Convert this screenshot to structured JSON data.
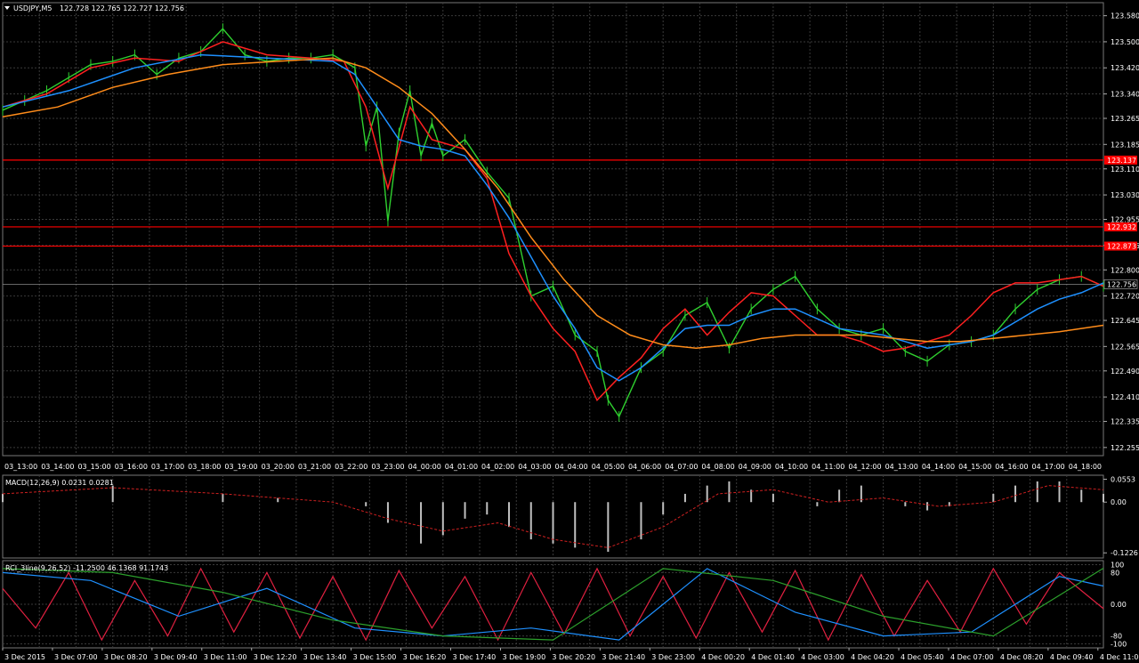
{
  "chart_data": [
    {
      "type": "line",
      "title": "USDJPY,M5",
      "ohlc_text": "122.728 122.765 122.727 122.756",
      "ylim": [
        122.23,
        123.62
      ],
      "y_ticks": [
        "123.580",
        "123.500",
        "123.420",
        "123.340",
        "123.265",
        "123.185",
        "123.110",
        "123.030",
        "122.955",
        "122.875",
        "122.800",
        "122.720",
        "122.645",
        "122.565",
        "122.490",
        "122.410",
        "122.335",
        "122.255"
      ],
      "x_markers": [
        "03_13:00",
        "03_14:00",
        "03_15:00",
        "03_16:00",
        "03_17:00",
        "03_18:00",
        "03_19:00",
        "03_20:00",
        "03_21:00",
        "03_22:00",
        "03_23:00",
        "04_00:00",
        "04_01:00",
        "04_02:00",
        "04_03:00",
        "04_04:00",
        "04_05:00",
        "04_06:00",
        "04_07:00",
        "04_08:00",
        "04_09:00",
        "04_10:00",
        "04_11:00",
        "04_12:00",
        "04_13:00",
        "04_14:00",
        "04_15:00",
        "04_16:00",
        "04_17:00",
        "04_18:00"
      ],
      "x_labels": [
        "3 Dec 2015",
        "3 Dec 07:00",
        "3 Dec 08:20",
        "3 Dec 09:40",
        "3 Dec 11:00",
        "3 Dec 12:20",
        "3 Dec 13:40",
        "3 Dec 15:00",
        "3 Dec 16:20",
        "3 Dec 17:40",
        "3 Dec 19:00",
        "3 Dec 20:20",
        "3 Dec 21:40",
        "3 Dec 23:00",
        "4 Dec 00:20",
        "4 Dec 01:40",
        "4 Dec 03:00",
        "4 Dec 04:20",
        "4 Dec 05:40",
        "4 Dec 07:00",
        "4 Dec 08:20",
        "4 Dec 09:40",
        "4 Dec 11:00"
      ],
      "horizontal_levels": [
        {
          "value": 123.137,
          "label": "123.137",
          "color": "#ff0000"
        },
        {
          "value": 122.932,
          "label": "122.932",
          "color": "#ff0000"
        },
        {
          "value": 122.873,
          "label": "122.873",
          "color": "#ff0000"
        }
      ],
      "current_price": {
        "value": 122.756,
        "label": "122.756"
      },
      "price_color": "#2fd02f",
      "series": [
        {
          "color": "#2fd02f",
          "role": "price",
          "x": [
            0,
            0.02,
            0.04,
            0.06,
            0.08,
            0.1,
            0.12,
            0.14,
            0.16,
            0.18,
            0.2,
            0.22,
            0.24,
            0.26,
            0.28,
            0.3,
            0.32,
            0.33,
            0.34,
            0.35,
            0.36,
            0.37,
            0.38,
            0.39,
            0.4,
            0.42,
            0.44,
            0.46,
            0.48,
            0.5,
            0.52,
            0.54,
            0.55,
            0.56,
            0.58,
            0.6,
            0.62,
            0.64,
            0.66,
            0.68,
            0.7,
            0.72,
            0.74,
            0.76,
            0.78,
            0.8,
            0.82,
            0.84,
            0.86,
            0.88,
            0.9,
            0.92,
            0.94,
            0.96,
            0.98,
            1
          ],
          "y": [
            123.29,
            123.32,
            123.35,
            123.39,
            123.43,
            123.44,
            123.46,
            123.4,
            123.45,
            123.47,
            123.54,
            123.46,
            123.44,
            123.45,
            123.45,
            123.46,
            123.42,
            123.18,
            123.3,
            122.95,
            123.22,
            123.35,
            123.15,
            123.25,
            123.15,
            123.2,
            123.1,
            123.02,
            122.72,
            122.75,
            122.6,
            122.55,
            122.4,
            122.35,
            122.5,
            122.55,
            122.66,
            122.7,
            122.56,
            122.68,
            122.74,
            122.78,
            122.68,
            122.62,
            122.6,
            122.62,
            122.55,
            122.52,
            122.57,
            122.58,
            122.6,
            122.68,
            122.74,
            122.77,
            122.78,
            122.75
          ]
        },
        {
          "color": "#ff2020",
          "role": "fast-ma",
          "x": [
            0,
            0.04,
            0.08,
            0.12,
            0.16,
            0.2,
            0.24,
            0.28,
            0.31,
            0.33,
            0.35,
            0.37,
            0.39,
            0.42,
            0.44,
            0.46,
            0.48,
            0.5,
            0.52,
            0.54,
            0.56,
            0.58,
            0.6,
            0.62,
            0.64,
            0.66,
            0.68,
            0.7,
            0.72,
            0.74,
            0.76,
            0.78,
            0.8,
            0.82,
            0.84,
            0.86,
            0.88,
            0.9,
            0.92,
            0.94,
            0.96,
            0.98,
            1
          ],
          "y": [
            123.3,
            123.34,
            123.42,
            123.45,
            123.44,
            123.5,
            123.46,
            123.45,
            123.44,
            123.3,
            123.05,
            123.3,
            123.2,
            123.17,
            123.08,
            122.85,
            122.72,
            122.62,
            122.55,
            122.4,
            122.47,
            122.53,
            122.62,
            122.68,
            122.6,
            122.67,
            122.73,
            122.72,
            122.66,
            122.6,
            122.6,
            122.58,
            122.55,
            122.56,
            122.58,
            122.6,
            122.66,
            122.73,
            122.76,
            122.76,
            122.77,
            122.78,
            122.75
          ]
        },
        {
          "color": "#1e90ff",
          "role": "mid-ma",
          "x": [
            0,
            0.06,
            0.12,
            0.18,
            0.24,
            0.3,
            0.32,
            0.34,
            0.36,
            0.38,
            0.4,
            0.42,
            0.44,
            0.46,
            0.48,
            0.5,
            0.52,
            0.54,
            0.56,
            0.58,
            0.6,
            0.62,
            0.64,
            0.66,
            0.68,
            0.7,
            0.72,
            0.74,
            0.76,
            0.78,
            0.8,
            0.82,
            0.84,
            0.86,
            0.88,
            0.9,
            0.92,
            0.94,
            0.96,
            0.98,
            1
          ],
          "y": [
            123.3,
            123.35,
            123.42,
            123.46,
            123.45,
            123.44,
            123.4,
            123.3,
            123.2,
            123.18,
            123.17,
            123.15,
            123.06,
            122.96,
            122.84,
            122.72,
            122.62,
            122.5,
            122.46,
            122.5,
            122.56,
            122.62,
            122.63,
            122.63,
            122.66,
            122.68,
            122.68,
            122.65,
            122.62,
            122.61,
            122.6,
            122.58,
            122.56,
            122.57,
            122.58,
            122.6,
            122.64,
            122.68,
            122.71,
            122.73,
            122.76
          ]
        },
        {
          "color": "#ff8c1a",
          "role": "slow-ma",
          "x": [
            0,
            0.05,
            0.1,
            0.15,
            0.2,
            0.25,
            0.3,
            0.33,
            0.36,
            0.39,
            0.42,
            0.45,
            0.48,
            0.51,
            0.54,
            0.57,
            0.6,
            0.63,
            0.66,
            0.69,
            0.72,
            0.75,
            0.78,
            0.81,
            0.84,
            0.87,
            0.9,
            0.93,
            0.96,
            1
          ],
          "y": [
            123.27,
            123.3,
            123.36,
            123.4,
            123.43,
            123.44,
            123.45,
            123.42,
            123.36,
            123.28,
            123.17,
            123.05,
            122.9,
            122.77,
            122.66,
            122.6,
            122.57,
            122.56,
            122.57,
            122.59,
            122.6,
            122.6,
            122.6,
            122.59,
            122.58,
            122.58,
            122.59,
            122.6,
            122.61,
            122.63
          ]
        }
      ]
    },
    {
      "type": "bar",
      "title": "MACD(12,26,9) 0.0231 0.0281",
      "ylim": [
        -0.135,
        0.065
      ],
      "y_ticks": [
        "0.0553",
        "0.00",
        "-0.1226"
      ],
      "bar_color": "#c0c0c0",
      "signal_color": "#d02020",
      "histogram": {
        "x": [
          0,
          0.1,
          0.2,
          0.25,
          0.3,
          0.33,
          0.35,
          0.38,
          0.4,
          0.42,
          0.44,
          0.46,
          0.48,
          0.5,
          0.52,
          0.55,
          0.58,
          0.6,
          0.62,
          0.64,
          0.66,
          0.68,
          0.7,
          0.72,
          0.74,
          0.76,
          0.78,
          0.8,
          0.82,
          0.84,
          0.86,
          0.88,
          0.9,
          0.92,
          0.94,
          0.96,
          0.98,
          1
        ],
        "y": [
          0.02,
          0.04,
          0.02,
          0.01,
          0.0,
          -0.01,
          -0.05,
          -0.1,
          -0.08,
          -0.04,
          -0.03,
          -0.06,
          -0.09,
          -0.1,
          -0.11,
          -0.12,
          -0.09,
          -0.03,
          0.02,
          0.04,
          0.05,
          0.03,
          0.02,
          0.0,
          -0.01,
          0.03,
          0.04,
          0.0,
          -0.01,
          -0.02,
          -0.01,
          0.0,
          0.02,
          0.04,
          0.05,
          0.05,
          0.03,
          0.02
        ]
      },
      "signal": {
        "x": [
          0,
          0.1,
          0.2,
          0.3,
          0.35,
          0.4,
          0.45,
          0.5,
          0.55,
          0.6,
          0.65,
          0.7,
          0.75,
          0.8,
          0.85,
          0.9,
          0.95,
          1
        ],
        "y": [
          0.02,
          0.035,
          0.02,
          0.0,
          -0.04,
          -0.07,
          -0.05,
          -0.09,
          -0.11,
          -0.06,
          0.02,
          0.03,
          0.0,
          0.01,
          -0.01,
          0.0,
          0.04,
          0.03
        ]
      }
    },
    {
      "type": "line",
      "title": "RCI_3line(9,26,52) -11.2500 46.1368 91.1743",
      "ylim": [
        -110,
        110
      ],
      "y_ticks": [
        "100",
        "80",
        "0.00",
        "-80",
        "-100"
      ],
      "series": [
        {
          "color": "#e02040",
          "x": [
            0,
            0.03,
            0.06,
            0.09,
            0.12,
            0.15,
            0.18,
            0.21,
            0.24,
            0.27,
            0.3,
            0.33,
            0.36,
            0.39,
            0.42,
            0.45,
            0.48,
            0.51,
            0.54,
            0.57,
            0.6,
            0.63,
            0.66,
            0.69,
            0.72,
            0.75,
            0.78,
            0.81,
            0.84,
            0.87,
            0.9,
            0.93,
            0.96,
            1
          ],
          "y": [
            40,
            -60,
            80,
            -90,
            60,
            -80,
            90,
            -70,
            80,
            -85,
            70,
            -90,
            85,
            -60,
            70,
            -90,
            80,
            -75,
            90,
            -80,
            70,
            -85,
            80,
            -70,
            85,
            -90,
            75,
            -80,
            60,
            -70,
            90,
            -50,
            80,
            -11
          ]
        },
        {
          "color": "#1e90ff",
          "x": [
            0,
            0.08,
            0.16,
            0.24,
            0.32,
            0.4,
            0.48,
            0.56,
            0.64,
            0.72,
            0.8,
            0.88,
            0.96,
            1
          ],
          "y": [
            80,
            60,
            -30,
            40,
            -60,
            -80,
            -60,
            -90,
            90,
            -20,
            -80,
            -70,
            70,
            46
          ]
        },
        {
          "color": "#2ca02c",
          "x": [
            0,
            0.1,
            0.2,
            0.3,
            0.4,
            0.5,
            0.6,
            0.7,
            0.8,
            0.9,
            1
          ],
          "y": [
            90,
            80,
            30,
            -40,
            -80,
            -90,
            90,
            60,
            -30,
            -80,
            91
          ]
        }
      ]
    }
  ]
}
